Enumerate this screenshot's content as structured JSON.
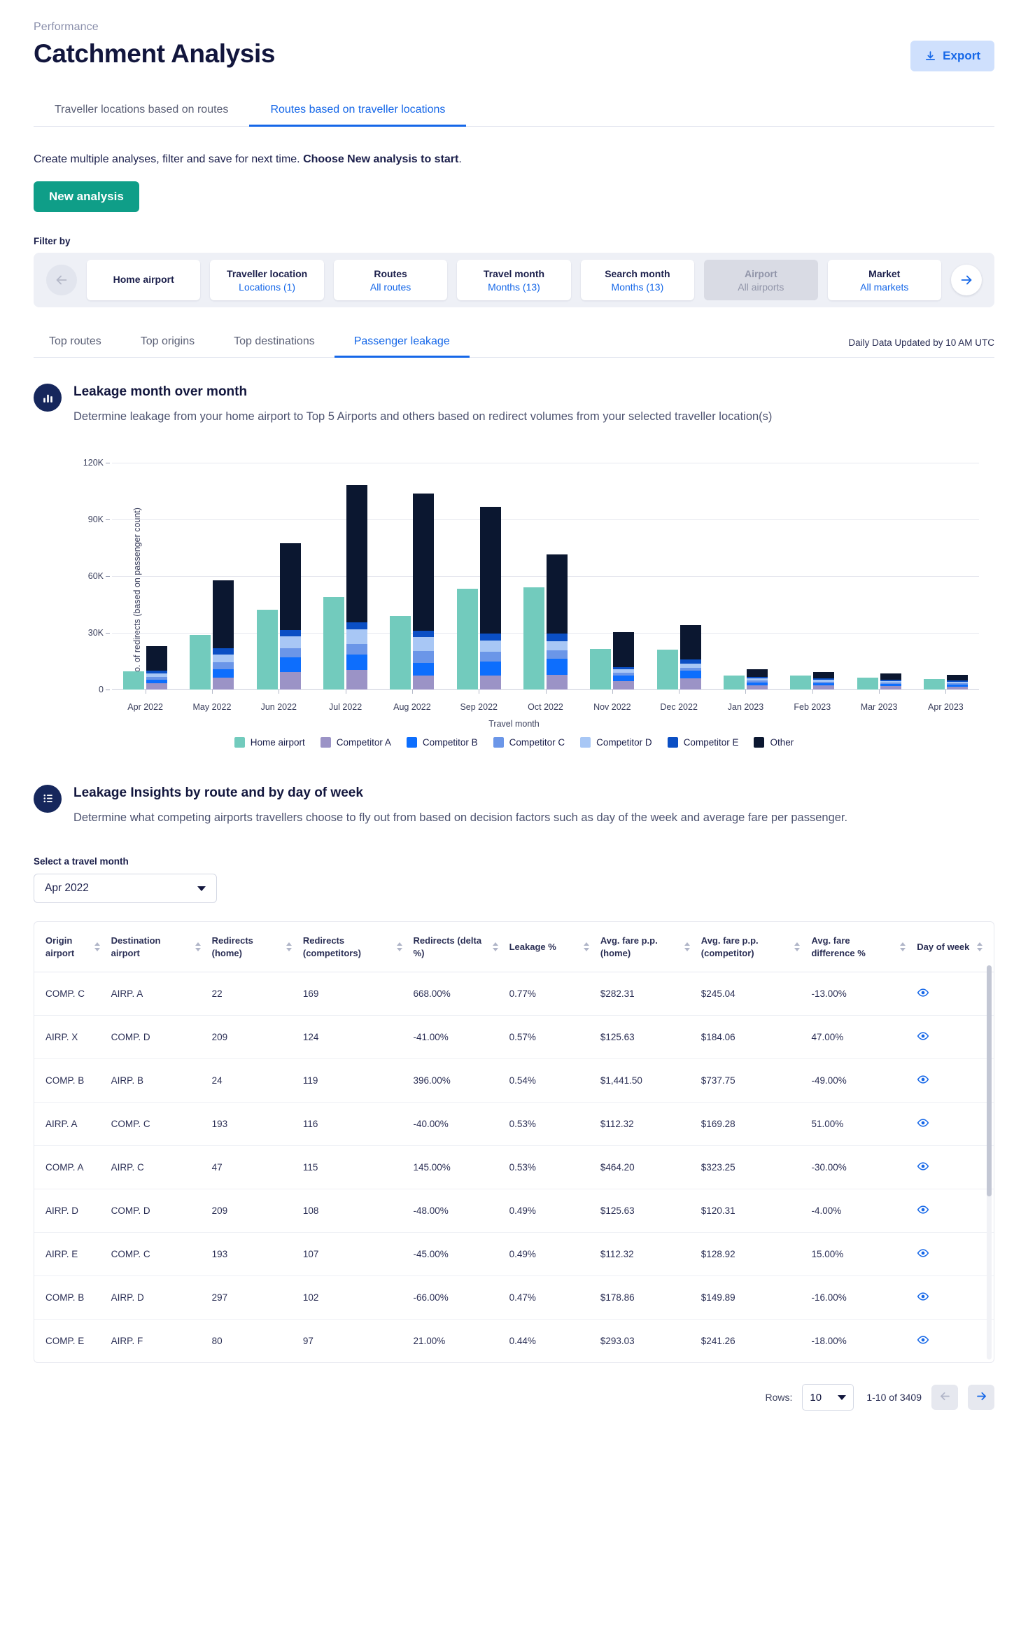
{
  "header": {
    "breadcrumb": "Performance",
    "title": "Catchment Analysis",
    "export_label": "Export"
  },
  "main_tabs": [
    {
      "label": "Traveller locations based on routes",
      "active": false
    },
    {
      "label": "Routes based on traveller locations",
      "active": true
    }
  ],
  "intro": {
    "text": "Create multiple analyses, filter and save for next time. ",
    "bold": "Choose New analysis to start",
    "period": ".",
    "new_analysis_label": "New analysis"
  },
  "filter": {
    "label": "Filter by",
    "prev_icon": "arrow-left-icon",
    "next_icon": "arrow-right-icon",
    "chips": [
      {
        "title": "Home airport",
        "value": "",
        "disabled": false
      },
      {
        "title": "Traveller location",
        "value": "Locations (1)",
        "disabled": false
      },
      {
        "title": "Routes",
        "value": "All routes",
        "disabled": false
      },
      {
        "title": "Travel month",
        "value": "Months (13)",
        "disabled": false
      },
      {
        "title": "Search month",
        "value": "Months (13)",
        "disabled": false
      },
      {
        "title": "Airport",
        "value": "All airports",
        "disabled": true
      },
      {
        "title": "Market",
        "value": "All markets",
        "disabled": false
      }
    ]
  },
  "sub_tabs": [
    {
      "label": "Top routes",
      "active": false
    },
    {
      "label": "Top origins",
      "active": false
    },
    {
      "label": "Top destinations",
      "active": false
    },
    {
      "label": "Passenger leakage",
      "active": true
    }
  ],
  "updated_note": "Daily Data Updated by 10 AM UTC",
  "section_chart": {
    "icon": "bar-chart-icon",
    "title": "Leakage month over month",
    "description": "Determine leakage from your home airport to Top 5 Airports and others based on redirect volumes from your selected traveller location(s)"
  },
  "section_table": {
    "icon": "list-icon",
    "title": "Leakage Insights by route and by day of week",
    "description": "Determine what competing airports travellers choose to fly out from based on decision factors such as day of the week and average fare per passenger."
  },
  "travel_month_select": {
    "label": "Select a travel month",
    "value": "Apr 2022",
    "caret_icon": "caret-down-icon"
  },
  "chart_data": {
    "type": "bar",
    "title": "",
    "xlabel": "Travel month",
    "ylabel": "No. of redirects (based on passenger count)",
    "ylim": [
      0,
      120000
    ],
    "yticks": [
      0,
      30000,
      60000,
      90000,
      120000
    ],
    "ytick_labels": [
      "0",
      "30K",
      "60K",
      "90K",
      "120K"
    ],
    "grid": true,
    "legend_position": "bottom",
    "stacked": true,
    "categories": [
      "Apr 2022",
      "May 2022",
      "Jun 2022",
      "Jul 2022",
      "Aug 2022",
      "Sep 2022",
      "Oct 2022",
      "Nov 2022",
      "Dec 2022",
      "Jan 2023",
      "Feb 2023",
      "Mar 2023",
      "Apr 2023"
    ],
    "colors": {
      "Home airport": "#72cbbd",
      "Competitor A": "#9b93c6",
      "Competitor B": "#0d6efd",
      "Competitor C": "#6b96e8",
      "Competitor D": "#a8c7f5",
      "Competitor E": "#0b4fc4",
      "Other": "#0b1730"
    },
    "series": [
      {
        "name": "Home airport",
        "values": [
          9500,
          28900,
          42200,
          48800,
          38800,
          53200,
          53800,
          21200,
          20800,
          7200,
          7100,
          6200,
          5400
        ]
      },
      {
        "name": "Competitor A",
        "values": [
          3200,
          6100,
          9100,
          10200,
          7300,
          7100,
          7600,
          4200,
          5800,
          2100,
          1900,
          1700,
          1500
        ]
      },
      {
        "name": "Competitor B",
        "values": [
          1700,
          4500,
          7800,
          8100,
          6600,
          7600,
          8400,
          3000,
          3900,
          1300,
          1200,
          1000,
          900
        ]
      },
      {
        "name": "Competitor C",
        "values": [
          1600,
          3700,
          4700,
          5600,
          6400,
          5000,
          4500,
          1600,
          1700,
          1100,
          900,
          800,
          700
        ]
      },
      {
        "name": "Competitor D",
        "values": [
          1900,
          4100,
          6500,
          7800,
          7400,
          6100,
          5000,
          1700,
          2200,
          1200,
          900,
          800,
          800
        ]
      },
      {
        "name": "Competitor E",
        "values": [
          1300,
          3400,
          3400,
          3700,
          3100,
          3800,
          4000,
          1200,
          2200,
          700,
          700,
          700,
          600
        ]
      },
      {
        "name": "Other",
        "values": [
          13300,
          35900,
          45700,
          72600,
          72600,
          66900,
          41900,
          18700,
          18200,
          4200,
          3500,
          3400,
          3300
        ]
      }
    ]
  },
  "table": {
    "columns": [
      {
        "label": "Origin airport",
        "sortable": true
      },
      {
        "label": "Destination airport",
        "sortable": true
      },
      {
        "label": "Redirects (home)",
        "sortable": true
      },
      {
        "label": "Redirects (competitors)",
        "sortable": true
      },
      {
        "label": "Redirects (delta %)",
        "sortable": true
      },
      {
        "label": "Leakage %",
        "sortable": true
      },
      {
        "label": "Avg. fare p.p. (home)",
        "sortable": true
      },
      {
        "label": "Avg. fare p.p. (competitor)",
        "sortable": true
      },
      {
        "label": "Avg. fare difference %",
        "sortable": true
      },
      {
        "label": "Day of week",
        "sortable": true
      }
    ],
    "rows": [
      {
        "origin": "COMP. C",
        "destination": "AIRP. A",
        "redirects_home": "22",
        "redirects_comp": "169",
        "redirects_delta": "668.00%",
        "leakage": "0.77%",
        "fare_home": "$282.31",
        "fare_comp": "$245.04",
        "fare_diff": "-13.00%",
        "day_icon": "eye-icon"
      },
      {
        "origin": "AIRP. X",
        "destination": "COMP. D",
        "redirects_home": "209",
        "redirects_comp": "124",
        "redirects_delta": "-41.00%",
        "leakage": "0.57%",
        "fare_home": "$125.63",
        "fare_comp": "$184.06",
        "fare_diff": "47.00%",
        "day_icon": "eye-icon"
      },
      {
        "origin": "COMP. B",
        "destination": "AIRP. B",
        "redirects_home": "24",
        "redirects_comp": "119",
        "redirects_delta": "396.00%",
        "leakage": "0.54%",
        "fare_home": "$1,441.50",
        "fare_comp": "$737.75",
        "fare_diff": "-49.00%",
        "day_icon": "eye-icon"
      },
      {
        "origin": "AIRP. A",
        "destination": "COMP. C",
        "redirects_home": "193",
        "redirects_comp": "116",
        "redirects_delta": "-40.00%",
        "leakage": "0.53%",
        "fare_home": "$112.32",
        "fare_comp": "$169.28",
        "fare_diff": "51.00%",
        "day_icon": "eye-icon"
      },
      {
        "origin": "COMP. A",
        "destination": "AIRP. C",
        "redirects_home": "47",
        "redirects_comp": "115",
        "redirects_delta": "145.00%",
        "leakage": "0.53%",
        "fare_home": "$464.20",
        "fare_comp": "$323.25",
        "fare_diff": "-30.00%",
        "day_icon": "eye-icon"
      },
      {
        "origin": "AIRP. D",
        "destination": "COMP. D",
        "redirects_home": "209",
        "redirects_comp": "108",
        "redirects_delta": "-48.00%",
        "leakage": "0.49%",
        "fare_home": "$125.63",
        "fare_comp": "$120.31",
        "fare_diff": "-4.00%",
        "day_icon": "eye-icon"
      },
      {
        "origin": "AIRP. E",
        "destination": "COMP. C",
        "redirects_home": "193",
        "redirects_comp": "107",
        "redirects_delta": "-45.00%",
        "leakage": "0.49%",
        "fare_home": "$112.32",
        "fare_comp": "$128.92",
        "fare_diff": "15.00%",
        "day_icon": "eye-icon"
      },
      {
        "origin": "COMP. B",
        "destination": "AIRP. D",
        "redirects_home": "297",
        "redirects_comp": "102",
        "redirects_delta": "-66.00%",
        "leakage": "0.47%",
        "fare_home": "$178.86",
        "fare_comp": "$149.89",
        "fare_diff": "-16.00%",
        "day_icon": "eye-icon"
      },
      {
        "origin": "COMP. E",
        "destination": "AIRP. F",
        "redirects_home": "80",
        "redirects_comp": "97",
        "redirects_delta": "21.00%",
        "leakage": "0.44%",
        "fare_home": "$293.03",
        "fare_comp": "$241.26",
        "fare_diff": "-18.00%",
        "day_icon": "eye-icon"
      }
    ]
  },
  "pagination": {
    "rows_label": "Rows:",
    "rows_value": "10",
    "range": "1-10 of 3409",
    "prev_icon": "arrow-left-icon",
    "next_icon": "arrow-right-icon"
  }
}
